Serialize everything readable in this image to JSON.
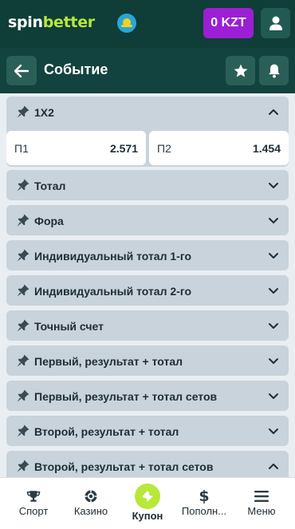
{
  "header": {
    "logo_part1": "spin",
    "logo_part2": "better",
    "balance": "0 KZT",
    "flag_icon": "kazakhstan-flag-icon",
    "user_icon": "user-icon"
  },
  "subheader": {
    "title": "Событие",
    "back_icon": "arrow-left-icon",
    "favorite_icon": "star-icon",
    "notify_icon": "bell-icon"
  },
  "markets": [
    {
      "title": "1X2",
      "expanded": true,
      "odds": [
        {
          "label": "П1",
          "value": "2.571"
        },
        {
          "label": "П2",
          "value": "1.454"
        }
      ]
    },
    {
      "title": "Тотал",
      "expanded": false
    },
    {
      "title": "Фора",
      "expanded": false
    },
    {
      "title": "Индивидуальный тотал 1-го",
      "expanded": false
    },
    {
      "title": "Индивидуальный тотал 2-го",
      "expanded": false
    },
    {
      "title": "Точный счет",
      "expanded": false
    },
    {
      "title": "Первый, результат + тотал",
      "expanded": false
    },
    {
      "title": "Первый, результат + тотал сетов",
      "expanded": false
    },
    {
      "title": "Второй, результат + тотал",
      "expanded": false
    },
    {
      "title": "Второй, результат + тотал сетов",
      "expanded": true
    }
  ],
  "bottom_nav": [
    {
      "label": "Спорт",
      "icon": "trophy-icon",
      "active": false
    },
    {
      "label": "Казино",
      "icon": "casino-chip-icon",
      "active": false
    },
    {
      "label": "Купон",
      "icon": "ticket-icon",
      "active": true
    },
    {
      "label": "Пополн...",
      "icon": "dollar-icon",
      "active": false
    },
    {
      "label": "Меню",
      "icon": "hamburger-menu-icon",
      "active": false
    }
  ],
  "colors": {
    "header_bg": "#0f3d38",
    "subheader_bg": "#12433e",
    "accent_purple": "#9c1fd6",
    "accent_lime": "#b7e83a",
    "section_bg": "#c8d3dc"
  }
}
